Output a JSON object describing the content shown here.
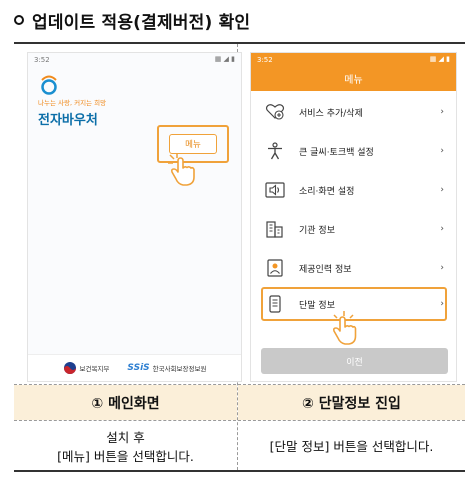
{
  "heading": "업데이트 적용(결제버전) 확인",
  "screen1": {
    "status_time": "3:52",
    "status_icons": "▦ ◢ ▮",
    "tagline": "나누는 사랑, 커지는 희망",
    "app_title": "전자바우처",
    "menu_button": "메뉴",
    "footer": {
      "org1": "보건복지부",
      "org2_logo": "SSiS",
      "org2": "한국사회보장정보원"
    }
  },
  "screen2": {
    "status_time": "3:52",
    "status_icons": "▦ ◢ ▮",
    "title": "메뉴",
    "items": [
      {
        "icon": "service-add-icon",
        "label": "서비스 추가/삭제"
      },
      {
        "icon": "accessibility-icon",
        "label": "큰 글씨·토크백 설정"
      },
      {
        "icon": "speaker-icon",
        "label": "소리·화면 설정"
      },
      {
        "icon": "building-icon",
        "label": "기관 정보"
      },
      {
        "icon": "person-card-icon",
        "label": "제공인력 정보"
      },
      {
        "icon": "phone-device-icon",
        "label": "단말 정보"
      }
    ],
    "chevron": "›",
    "prev_button": "이전",
    "highlight_index": 5
  },
  "captions": {
    "left": "① 메인화면",
    "right": "② 단말정보 진입"
  },
  "descriptions": {
    "left_line1": "설치 후",
    "left_line2": "[메뉴] 버튼을 선택합니다.",
    "right": "[단말 정보] 버튼을 선택합니다."
  },
  "colors": {
    "accent_orange": "#f39625",
    "caption_bg": "#fbefd9",
    "brand_blue": "#0b6ea8"
  }
}
